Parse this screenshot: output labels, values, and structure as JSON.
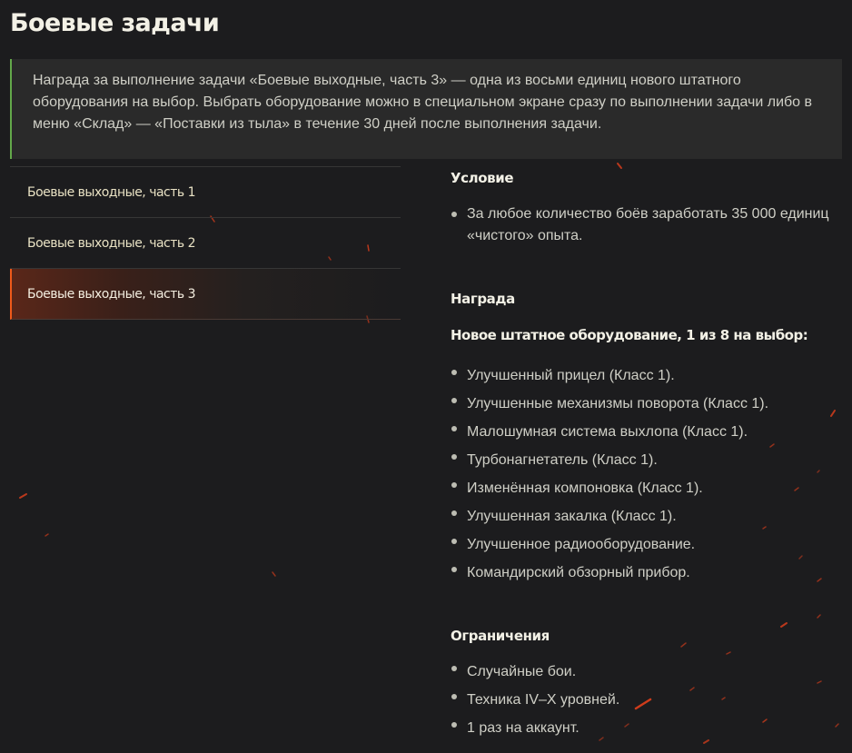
{
  "page": {
    "title": "Боевые задачи"
  },
  "notice": {
    "text": "Награда за выполнение задачи «Боевые выходные, часть 3» — одна из восьми единиц нового штатного оборудования на выбор. Выбрать оборудование можно в специальном экране сразу по выполнении задачи либо в меню «Склад» — «Поставки из тыла» в течение 30 дней после выполнения задачи."
  },
  "tabs": [
    {
      "label": "Боевые выходные, часть 1",
      "active": false
    },
    {
      "label": "Боевые выходные, часть 2",
      "active": false
    },
    {
      "label": "Боевые выходные, часть 3",
      "active": true
    }
  ],
  "condition": {
    "heading": "Условие",
    "items": [
      "За любое количество боёв заработать 35 000 единиц «чистого» опыта."
    ]
  },
  "reward": {
    "heading": "Награда",
    "subheading": "Новое штатное оборудование, 1 из 8 на выбор:",
    "items": [
      "Улучшенный прицел (Класс 1).",
      "Улучшенные механизмы поворота (Класс 1).",
      "Малошумная система выхлопа (Класс 1).",
      "Турбонагнетатель (Класс 1).",
      "Изменённая компоновка (Класс 1).",
      "Улучшенная закалка (Класс 1).",
      "Улучшенное радиооборудование.",
      "Командирский обзорный прибор."
    ]
  },
  "restrictions": {
    "heading": "Ограничения",
    "items": [
      "Случайные бои.",
      "Техника IV–X уровней.",
      "1 раз на аккаунт."
    ]
  },
  "colors": {
    "background": "#1c1c1e",
    "notice_background": "#2a2a2a",
    "notice_accent": "#63a84a",
    "active_tab_accent": "#f05a1a",
    "spark": "#e2401b"
  }
}
